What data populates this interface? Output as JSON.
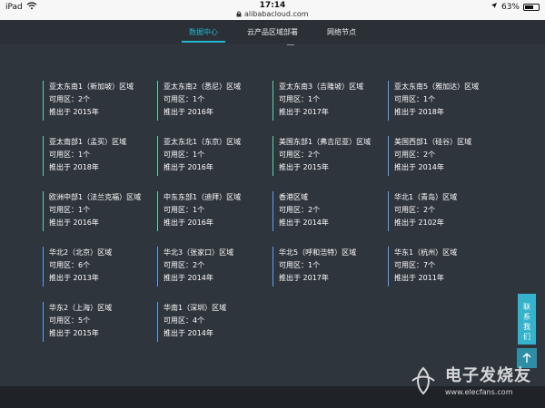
{
  "status_bar": {
    "device": "iPad",
    "time": "17:14",
    "url": "alibabacloud.com",
    "battery_text": "63%",
    "battery_level": 0.63
  },
  "nav": {
    "tabs": [
      {
        "label": "数据中心",
        "active": true
      },
      {
        "label": "云产品区域部署",
        "active": false
      },
      {
        "label": "网络节点",
        "active": false
      }
    ]
  },
  "regions": [
    {
      "name": "亚太东南1（新加坡）区域",
      "zones": "可用区：2个",
      "launch": "推出于 2015年"
    },
    {
      "name": "亚太东南2（悉尼）区域",
      "zones": "可用区：1个",
      "launch": "推出于 2016年"
    },
    {
      "name": "亚太东南3（吉隆坡）区域",
      "zones": "可用区：1个",
      "launch": "推出于 2017年"
    },
    {
      "name": "亚太东南5（雅加达）区域",
      "zones": "可用区：1个",
      "launch": "推出于 2018年"
    },
    {
      "name": "亚太南部1（孟买）区域",
      "zones": "可用区：1个",
      "launch": "推出于 2018年"
    },
    {
      "name": "亚太东北1（东京）区域",
      "zones": "可用区：1个",
      "launch": "推出于 2016年"
    },
    {
      "name": "美国东部1（弗吉尼亚）区域",
      "zones": "可用区：2个",
      "launch": "推出于 2015年"
    },
    {
      "name": "美国西部1（硅谷）区域",
      "zones": "可用区：2个",
      "launch": "推出于 2014年"
    },
    {
      "name": "欧洲中部1（法兰克福）区域",
      "zones": "可用区：1个",
      "launch": "推出于 2016年"
    },
    {
      "name": "中东东部1（迪拜）区域",
      "zones": "可用区：1个",
      "launch": "推出于 2016年"
    },
    {
      "name": "香港区域",
      "zones": "可用区：2个",
      "launch": "推出于 2014年"
    },
    {
      "name": "华北1（青岛）区域",
      "zones": "可用区：2个",
      "launch": "推出于 2102年"
    },
    {
      "name": "华北2（北京）区域",
      "zones": "可用区：6个",
      "launch": "推出于 2013年"
    },
    {
      "name": "华北3（张家口）区域",
      "zones": "可用区：2个",
      "launch": "推出于 2014年"
    },
    {
      "name": "华北5（呼和浩特）区域",
      "zones": "可用区：1个",
      "launch": "推出于 2017年"
    },
    {
      "name": "华东1（杭州）区域",
      "zones": "可用区：7个",
      "launch": "推出于 2011年"
    },
    {
      "name": "华东2（上海）区域",
      "zones": "可用区：5个",
      "launch": "推出于 2015年"
    },
    {
      "name": "华南1（深圳）区域",
      "zones": "可用区：4个",
      "launch": "推出于 2014年"
    }
  ],
  "contact": {
    "label": "联系我们"
  },
  "watermark": {
    "cn": "电子发烧友",
    "en": "www.elecfans.com"
  },
  "colors": {
    "accent": "#22b8cf",
    "green_line": "#5fd3a6",
    "blue_line": "#54a0ff",
    "background": "#2f353c"
  }
}
